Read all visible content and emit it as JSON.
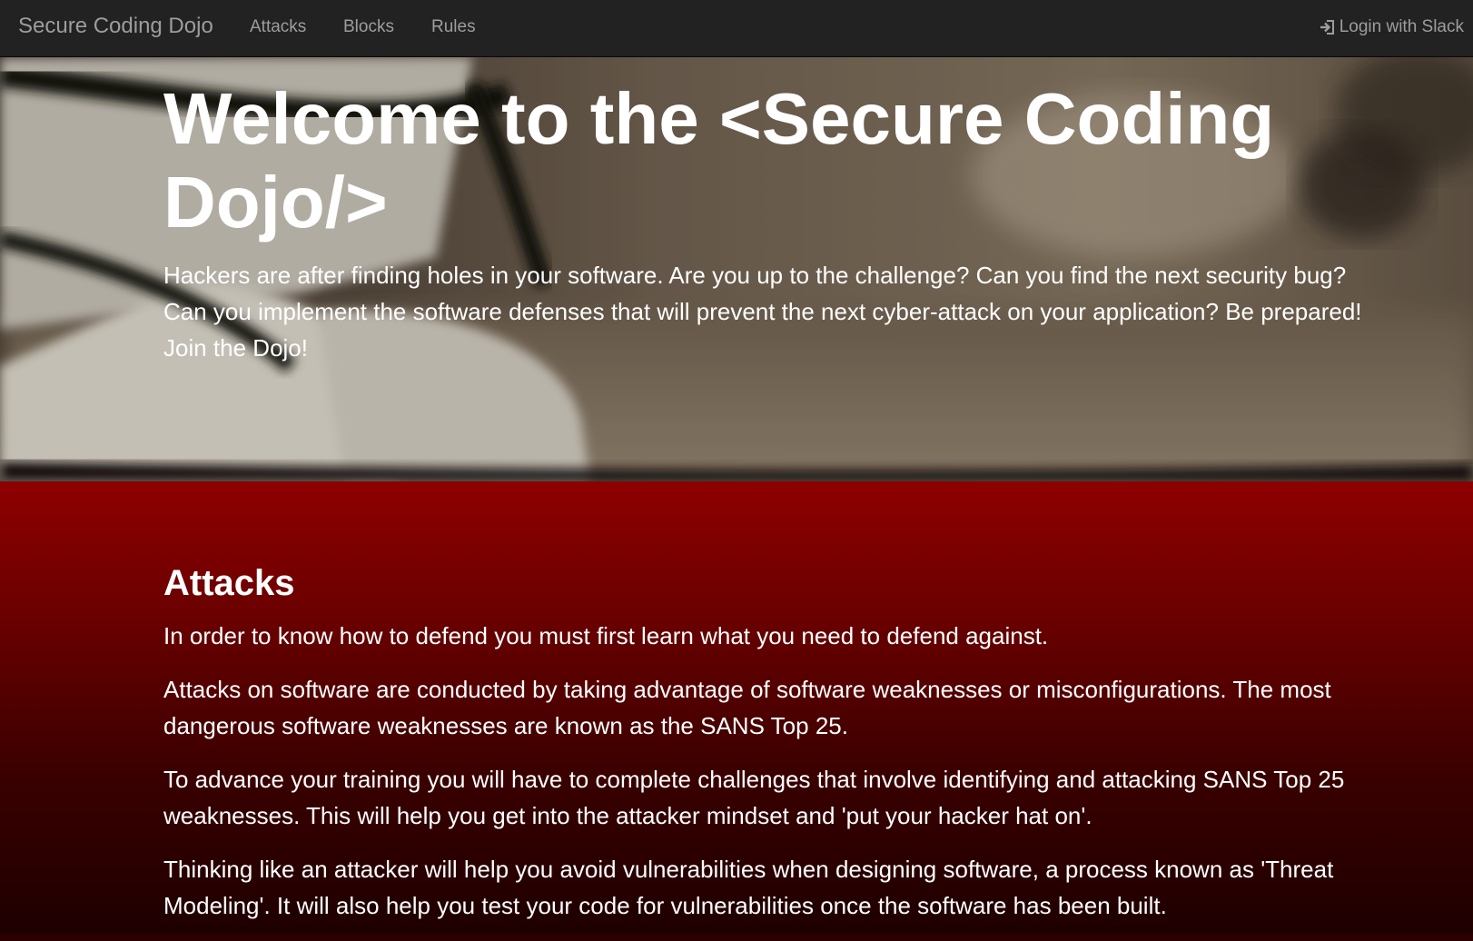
{
  "navbar": {
    "brand": "Secure Coding Dojo",
    "links": [
      "Attacks",
      "Blocks",
      "Rules"
    ],
    "login_label": "Login with Slack",
    "login_icon": "log-in-icon"
  },
  "hero": {
    "title": "Welcome to the <Secure Coding Dojo/>",
    "text": "Hackers are after finding holes in your software. Are you up to the challenge? Can you find the next security bug? Can you implement the software defenses that will prevent the next cyber-attack on your application? Be prepared! Join the Dojo!"
  },
  "attacks": {
    "title": "Attacks",
    "paragraphs": [
      "In order to know how to defend you must first learn what you need to defend against.",
      "Attacks on software are conducted by taking advantage of software weaknesses or misconfigurations. The most dangerous software weaknesses are known as the SANS Top 25.",
      "To advance your training you will have to complete challenges that involve identifying and attacking SANS Top 25 weaknesses. This will help you get into the attacker mindset and 'put your hacker hat on'.",
      "Thinking like an attacker will help you avoid vulnerabilities when designing software, a process known as 'Threat Modeling'. It will also help you test your code for vulnerabilities once the software has been built."
    ]
  },
  "colors": {
    "navbar": "#222222",
    "nav_text": "#9d9d9d",
    "section_top": "#8e0000",
    "section_bottom": "#1e0000"
  }
}
